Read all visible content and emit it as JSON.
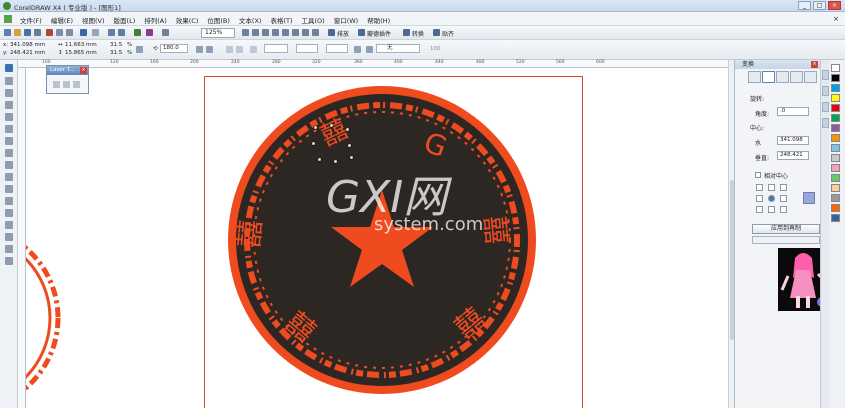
{
  "window": {
    "title": "CorelDRAW X4 ( 专业版 ) - [图形1]",
    "buttons": [
      "_",
      "□",
      "×"
    ]
  },
  "menu": {
    "items": [
      "文件(F)",
      "编辑(E)",
      "视图(V)",
      "版面(L)",
      "排列(A)",
      "效果(C)",
      "位图(B)",
      "文本(X)",
      "表格(T)",
      "工具(O)",
      "窗口(W)",
      "帮助(H)"
    ],
    "close": "×"
  },
  "toolbar": {
    "zoom": "125%",
    "labels": [
      "排放",
      "瓣德插件",
      "转换",
      "贴齐"
    ]
  },
  "property_bar": {
    "x": "341.098 mm",
    "y": "248.421 mm",
    "width": "11.663 mm",
    "height": "15.865 mm",
    "scale_x": "31.5",
    "scale_y": "31.5",
    "percent": "%",
    "rotation": "180.0",
    "fill": "无",
    "outline": "100"
  },
  "ruler": {
    "h_ticks": [
      "100",
      "120",
      "160",
      "200",
      "240",
      "280",
      "320",
      "360",
      "400",
      "440",
      "480",
      "520",
      "560",
      "600"
    ]
  },
  "laser_panel": {
    "title": "Laser T..."
  },
  "docker": {
    "title": "变换",
    "rotate_label": "旋转:",
    "angle_label": "角度:",
    "angle_value": ".0",
    "center_label": "中心:",
    "h_label": "水",
    "h_value": "341.098",
    "v_label": "垂直:",
    "v_value": "248.421",
    "relative_center": "相对中心",
    "apply_copy": "应用到再制"
  },
  "watermark": {
    "line1": "GXI网",
    "line2": "system.com"
  },
  "colors": {
    "accent_orange": "#ef4b1f",
    "dark_fill": "#2d2724"
  },
  "palette": [
    "#ffffff",
    "#000000",
    "#00a0e9",
    "#ffff00",
    "#e60012",
    "#00a651",
    "#8f5a9e",
    "#f39800",
    "#7fc4ef",
    "#c8c8c8",
    "#f5a0c0",
    "#66cc66",
    "#ffcc99",
    "#999999",
    "#ff6600",
    "#336699"
  ]
}
